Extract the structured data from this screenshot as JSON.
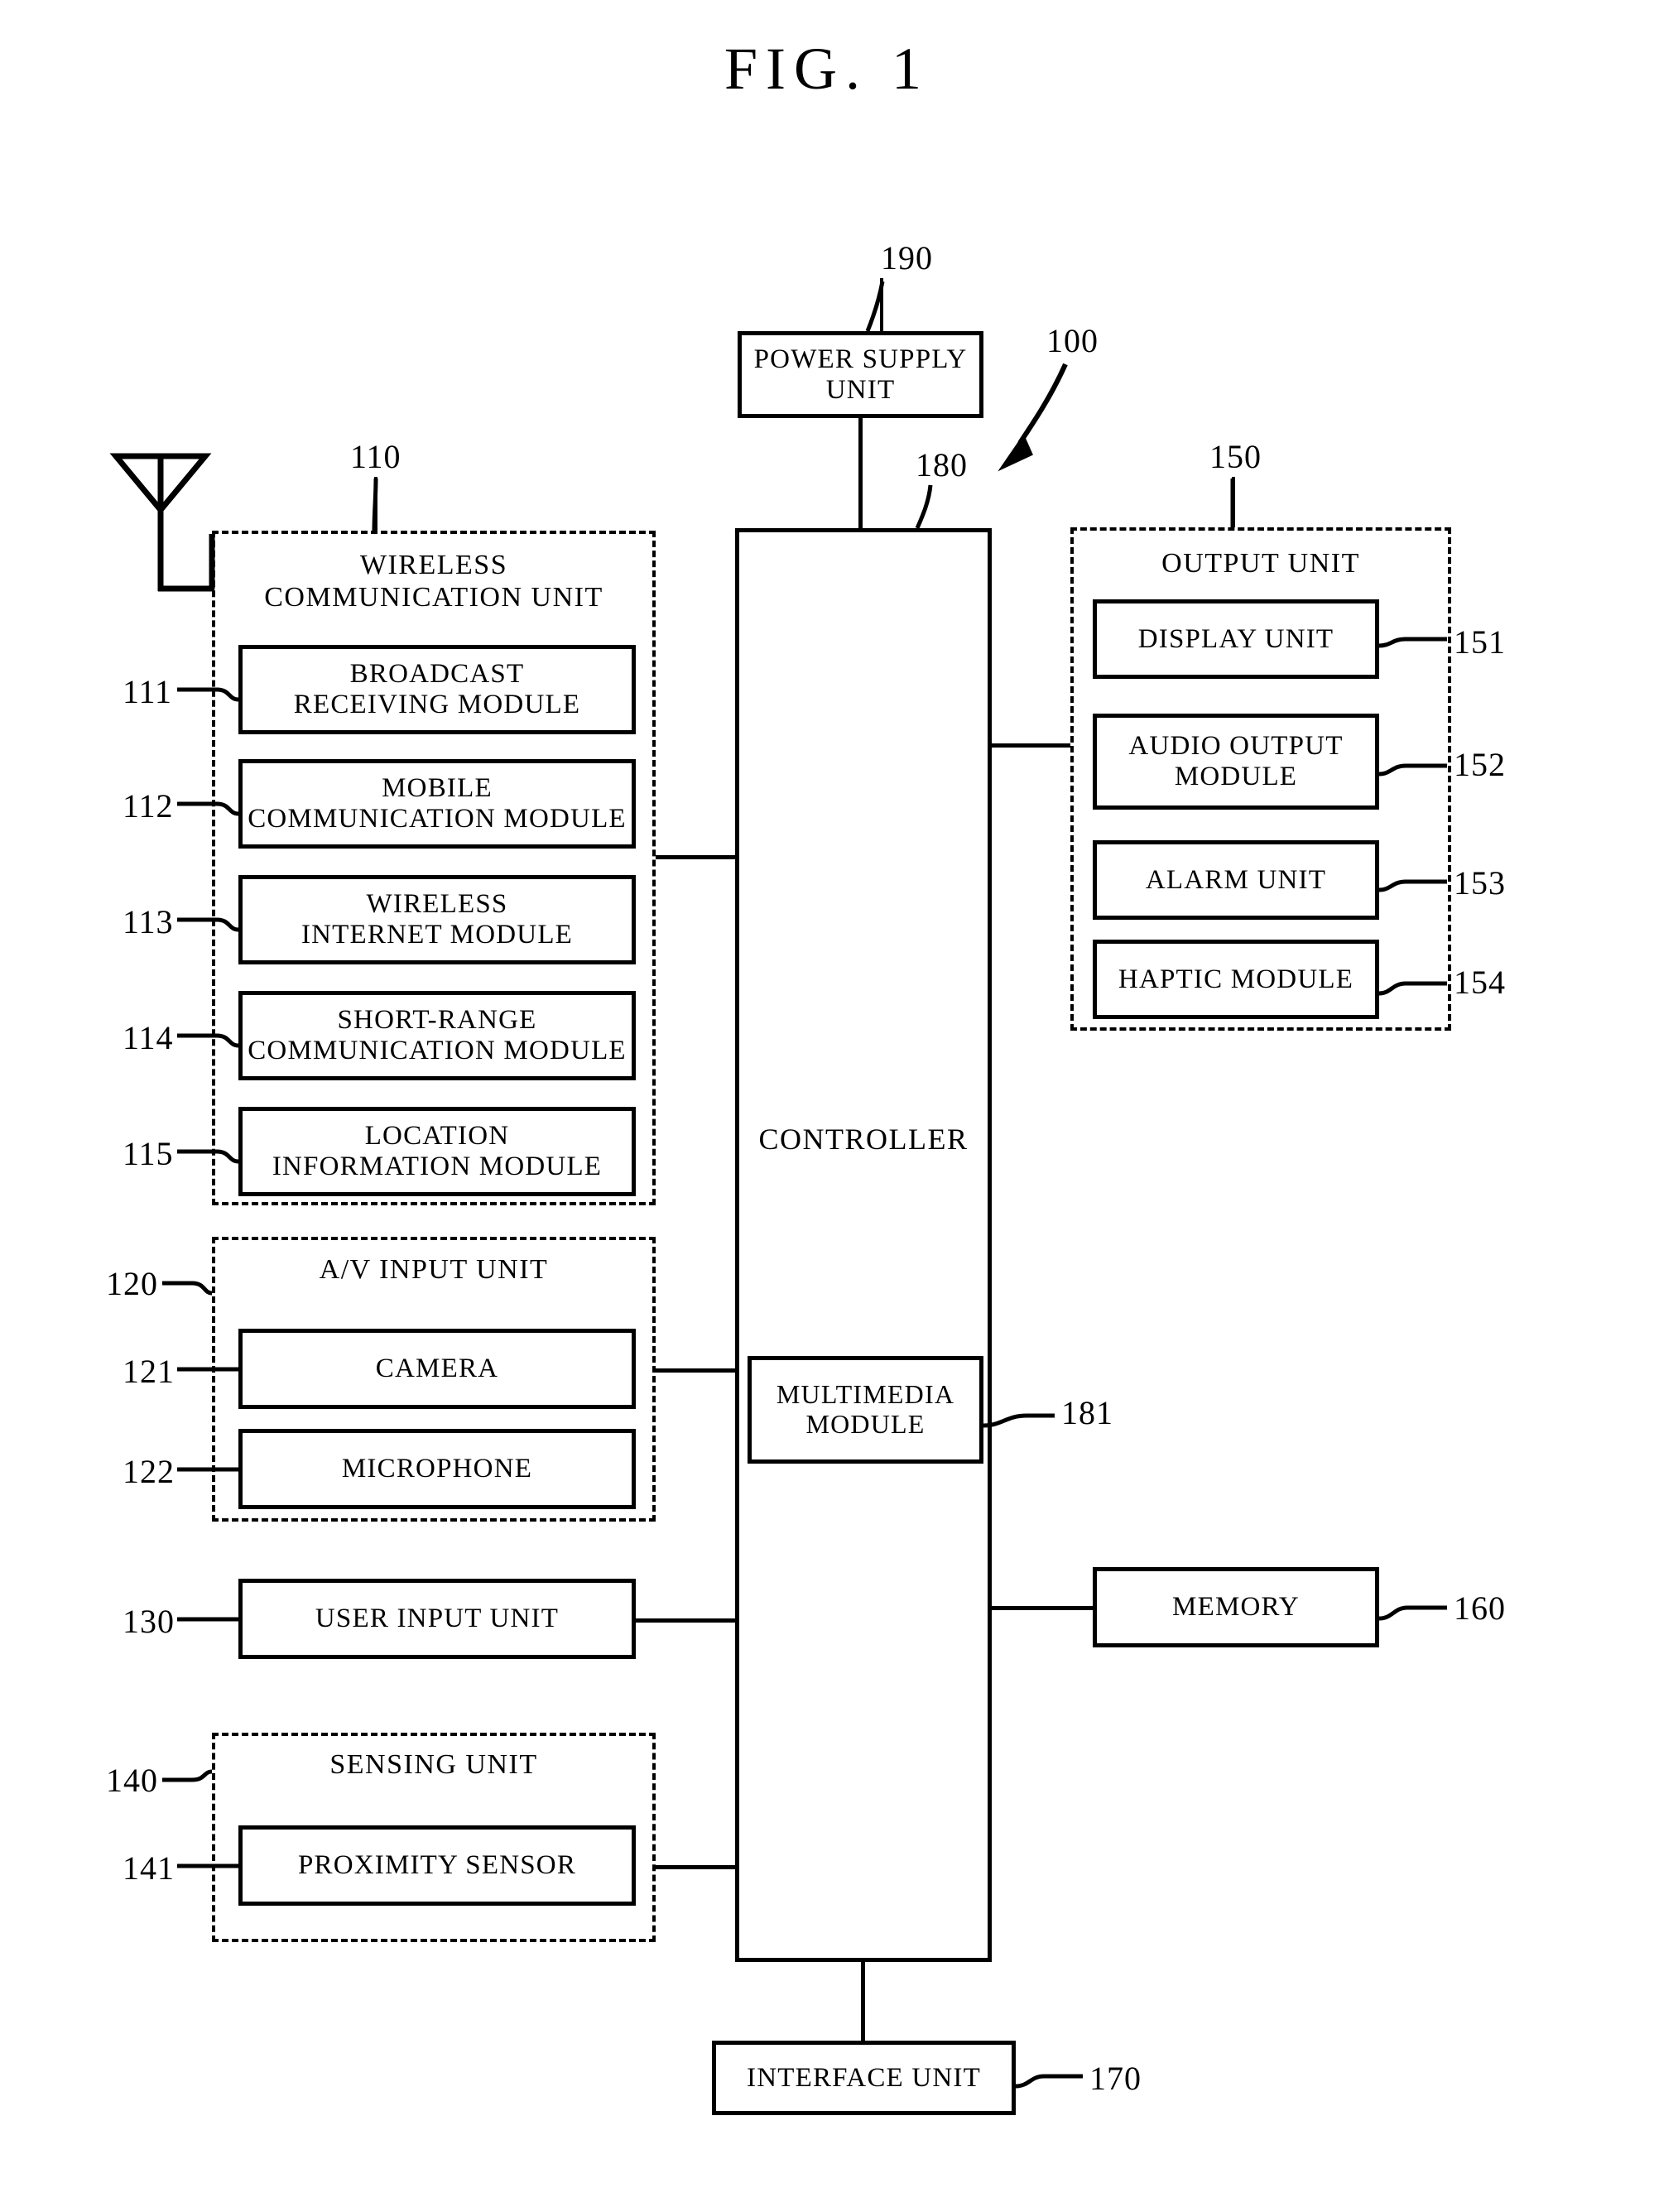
{
  "figure": {
    "title": "FIG. 1",
    "system_ref": "100"
  },
  "power_supply": {
    "label_line1": "POWER SUPPLY",
    "label_line2": "UNIT",
    "ref": "190"
  },
  "controller": {
    "label": "CONTROLLER",
    "ref": "180",
    "multimedia": {
      "label_line1": "MULTIMEDIA",
      "label_line2": "MODULE",
      "ref": "181"
    }
  },
  "wireless_communication_unit": {
    "title_line1": "WIRELESS",
    "title_line2": "COMMUNICATION UNIT",
    "ref": "110",
    "antenna_icon": "antenna-icon",
    "modules": [
      {
        "ref": "111",
        "line1": "BROADCAST",
        "line2": "RECEIVING MODULE"
      },
      {
        "ref": "112",
        "line1": "MOBILE",
        "line2": "COMMUNICATION MODULE"
      },
      {
        "ref": "113",
        "line1": "WIRELESS",
        "line2": "INTERNET MODULE"
      },
      {
        "ref": "114",
        "line1": "SHORT-RANGE",
        "line2": "COMMUNICATION MODULE"
      },
      {
        "ref": "115",
        "line1": "LOCATION",
        "line2": "INFORMATION MODULE"
      }
    ]
  },
  "av_input_unit": {
    "title": "A/V INPUT UNIT",
    "ref": "120",
    "modules": [
      {
        "ref": "121",
        "label": "CAMERA"
      },
      {
        "ref": "122",
        "label": "MICROPHONE"
      }
    ]
  },
  "user_input_unit": {
    "label": "USER INPUT UNIT",
    "ref": "130"
  },
  "sensing_unit": {
    "title": "SENSING UNIT",
    "ref": "140",
    "modules": [
      {
        "ref": "141",
        "label": "PROXIMITY SENSOR"
      }
    ]
  },
  "output_unit": {
    "title": "OUTPUT UNIT",
    "ref": "150",
    "modules": [
      {
        "ref": "151",
        "line1": "DISPLAY UNIT",
        "line2": ""
      },
      {
        "ref": "152",
        "line1": "AUDIO OUTPUT",
        "line2": "MODULE"
      },
      {
        "ref": "153",
        "line1": "ALARM UNIT",
        "line2": ""
      },
      {
        "ref": "154",
        "line1": "HAPTIC MODULE",
        "line2": ""
      }
    ]
  },
  "memory": {
    "label": "MEMORY",
    "ref": "160"
  },
  "interface_unit": {
    "label": "INTERFACE UNIT",
    "ref": "170"
  }
}
